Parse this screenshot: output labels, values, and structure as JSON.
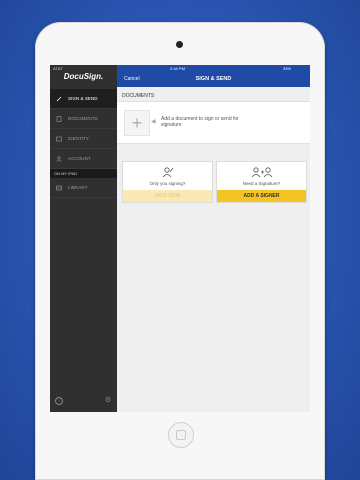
{
  "status_bar": {
    "carrier": "AT&T",
    "time": "2:44 PM",
    "battery": "33%"
  },
  "sidebar": {
    "logo": "DocuSign.",
    "items": [
      {
        "label": "SIGN & SEND",
        "active": true
      },
      {
        "label": "DOCUMENTS",
        "active": false
      },
      {
        "label": "IDENTITY",
        "active": false
      },
      {
        "label": "ACCOUNT",
        "active": false
      }
    ],
    "section_header": "ON MY IPAD",
    "section_items": [
      {
        "label": "LIBRARY"
      }
    ]
  },
  "header": {
    "cancel": "Cancel",
    "title": "SIGN & SEND"
  },
  "documents": {
    "section_title": "DOCUMENTS",
    "add_text": "Add a document to sign or send for signature"
  },
  "cards": {
    "only_you": {
      "question": "Only you signing?",
      "button": "SIGN NOW"
    },
    "need_signature": {
      "question": "Need a Signature?",
      "button": "ADD A SIGNER"
    }
  },
  "colors": {
    "accent_blue": "#1f4aa6",
    "cta_yellow": "#f5c324",
    "sidebar_dark": "#303030"
  }
}
